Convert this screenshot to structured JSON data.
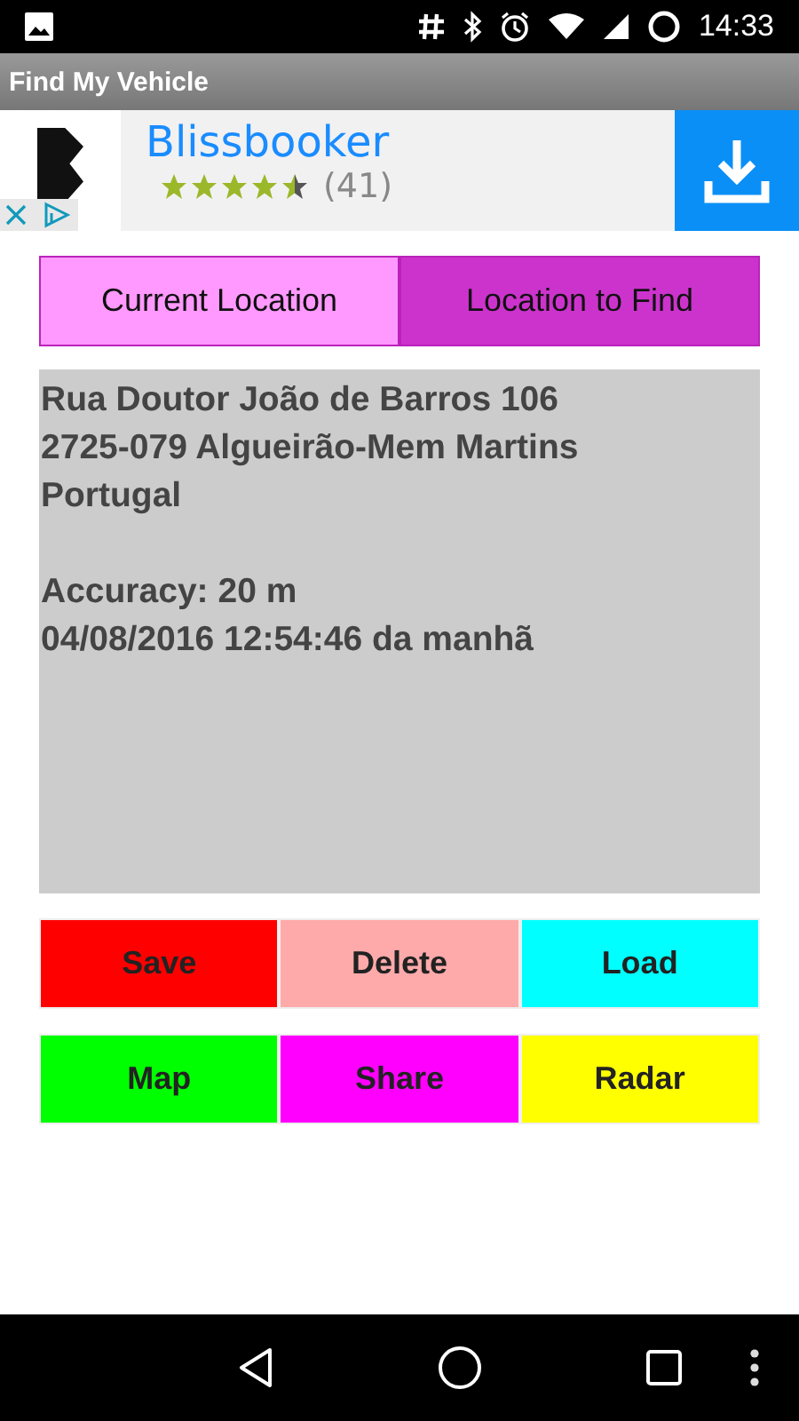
{
  "status_bar": {
    "time": "14:33"
  },
  "window": {
    "title": "Find My Vehicle"
  },
  "ad": {
    "name": "Blissbooker",
    "stars": 4.5,
    "count": "(41)"
  },
  "tabs": [
    {
      "label": "Current Location",
      "selected": false
    },
    {
      "label": "Location to Find",
      "selected": true
    }
  ],
  "location": {
    "address_lines": [
      "Rua Doutor João de Barros 106",
      "2725-079 Algueirão-Mem Martins",
      "Portugal"
    ],
    "accuracy": "Accuracy: 20 m",
    "timestamp": "04/08/2016 12:54:46 da manhã"
  },
  "button_rows": [
    [
      {
        "label": "Save",
        "color": "#ff0000"
      },
      {
        "label": "Delete",
        "color": "#ffaaaa"
      },
      {
        "label": "Load",
        "color": "#00ffff"
      }
    ],
    [
      {
        "label": "Map",
        "color": "#00ff00"
      },
      {
        "label": "Share",
        "color": "#ff00ff"
      },
      {
        "label": "Radar",
        "color": "#ffff00"
      }
    ]
  ]
}
